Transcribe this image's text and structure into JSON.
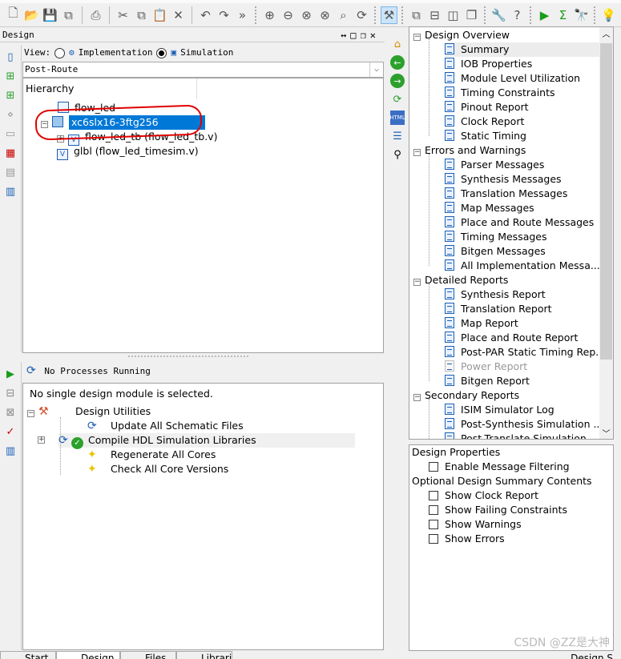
{
  "toolbar": {
    "overflow": "»",
    "icons": [
      "new-file-icon",
      "open-folder-icon",
      "save-icon",
      "save-all-icon",
      "print-icon",
      "cut-icon",
      "copy-icon",
      "paste-icon",
      "delete-icon",
      "undo-icon",
      "redo-icon",
      "zoom-in-icon",
      "zoom-out-icon",
      "zoom-fit-icon",
      "zoom-full-icon",
      "zoom-select-icon",
      "refresh-icon",
      "hammer-icon",
      "cascade-icon",
      "tile-horizontal-icon",
      "tile-vertical-icon",
      "windows-icon",
      "wrench-icon",
      "help-pointer-icon",
      "run-icon",
      "sigma-icon",
      "telescope-icon",
      "lightbulb-icon"
    ]
  },
  "design_panel": {
    "title": "Design",
    "view_label": "View:",
    "view_options": [
      {
        "label": "Implementation",
        "selected": false
      },
      {
        "label": "Simulation",
        "selected": true
      }
    ],
    "dropdown_value": "Post-Route",
    "hierarchy_header": "Hierarchy",
    "hierarchy": [
      {
        "label": "flow_led",
        "icon": "project-icon"
      },
      {
        "label": "xc6slx16-3ftg256",
        "icon": "chip-icon",
        "selected": true,
        "annotated": true
      },
      {
        "label": "flow_led_tb (flow_led_tb.v)",
        "icon": "verilog-file-icon"
      },
      {
        "label": "glbl (flow_led_timesim.v)",
        "icon": "verilog-file-icon"
      }
    ]
  },
  "process_panel": {
    "status": "No Processes Running",
    "message": "No single design module is selected.",
    "items": [
      {
        "label": "Design Utilities",
        "level": 0
      },
      {
        "label": "Update All Schematic Files",
        "level": 1
      },
      {
        "label": "Compile HDL Simulation Libraries",
        "level": 1,
        "status": "ok"
      },
      {
        "label": "Regenerate All Cores",
        "level": 1
      },
      {
        "label": "Check All Core Versions",
        "level": 1
      }
    ]
  },
  "bottom_tabs": [
    "Start",
    "Design",
    "Files",
    "Libraries"
  ],
  "report_tree": [
    {
      "label": "Design Overview",
      "level": 0
    },
    {
      "label": "Summary",
      "level": 1,
      "selected": true
    },
    {
      "label": "IOB Properties",
      "level": 1
    },
    {
      "label": "Module Level Utilization",
      "level": 1
    },
    {
      "label": "Timing Constraints",
      "level": 1
    },
    {
      "label": "Pinout Report",
      "level": 1
    },
    {
      "label": "Clock Report",
      "level": 1
    },
    {
      "label": "Static Timing",
      "level": 1
    },
    {
      "label": "Errors and Warnings",
      "level": 0
    },
    {
      "label": "Parser Messages",
      "level": 1
    },
    {
      "label": "Synthesis Messages",
      "level": 1
    },
    {
      "label": "Translation Messages",
      "level": 1
    },
    {
      "label": "Map Messages",
      "level": 1
    },
    {
      "label": "Place and Route Messages",
      "level": 1
    },
    {
      "label": "Timing Messages",
      "level": 1
    },
    {
      "label": "Bitgen Messages",
      "level": 1
    },
    {
      "label": "All Implementation Messa...",
      "level": 1
    },
    {
      "label": "Detailed Reports",
      "level": 0
    },
    {
      "label": "Synthesis Report",
      "level": 1
    },
    {
      "label": "Translation Report",
      "level": 1
    },
    {
      "label": "Map Report",
      "level": 1
    },
    {
      "label": "Place and Route Report",
      "level": 1
    },
    {
      "label": "Post-PAR Static Timing Rep...",
      "level": 1
    },
    {
      "label": "Power Report",
      "level": 1,
      "disabled": true
    },
    {
      "label": "Bitgen Report",
      "level": 1
    },
    {
      "label": "Secondary Reports",
      "level": 0
    },
    {
      "label": "ISIM Simulator Log",
      "level": 1
    },
    {
      "label": "Post-Synthesis Simulation ...",
      "level": 1
    },
    {
      "label": "Post-Translate Simulation ...",
      "level": 1
    }
  ],
  "properties": [
    {
      "label": "Design Properties",
      "type": "header"
    },
    {
      "label": "Enable Message Filtering",
      "type": "checkbox",
      "checked": false
    },
    {
      "label": "Optional Design Summary Contents",
      "type": "header"
    },
    {
      "label": "Show Clock Report",
      "type": "checkbox",
      "checked": false
    },
    {
      "label": "Show Failing Constraints",
      "type": "checkbox",
      "checked": false
    },
    {
      "label": "Show Warnings",
      "type": "checkbox",
      "checked": false
    },
    {
      "label": "Show Errors",
      "type": "checkbox",
      "checked": false
    }
  ],
  "bottom_right_tab": "Design S",
  "watermark": "CSDN @ZZ是大神",
  "colors": {
    "selection": "#0078d7",
    "annotation": "#e00000",
    "accent_green": "#2ca02c"
  }
}
